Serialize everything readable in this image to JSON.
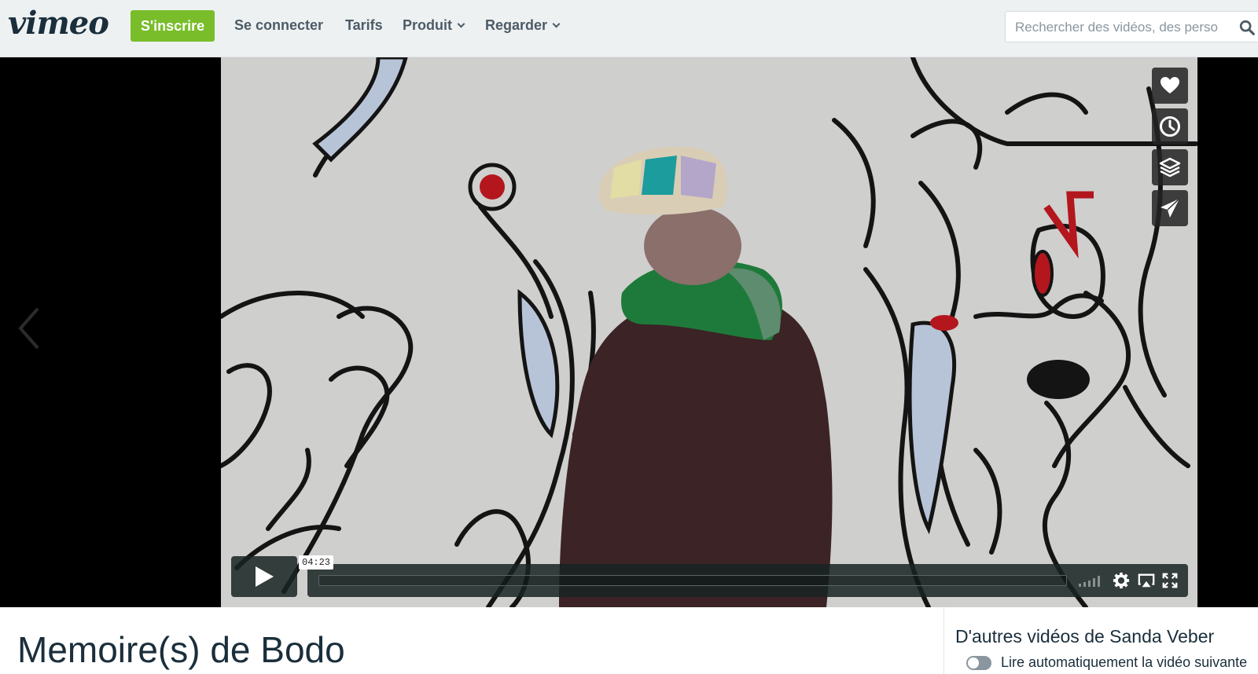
{
  "header": {
    "logo": "vimeo",
    "signup_label": "S'inscrire",
    "nav": [
      {
        "label": "Se connecter",
        "dropdown": false
      },
      {
        "label": "Tarifs",
        "dropdown": false
      },
      {
        "label": "Produit",
        "dropdown": true
      },
      {
        "label": "Regarder",
        "dropdown": true
      }
    ],
    "search_placeholder": "Rechercher des vidéos, des perso"
  },
  "player": {
    "timecode": "04:23",
    "side_actions": [
      "heart-icon",
      "clock-icon",
      "layers-icon",
      "send-icon"
    ],
    "controls": [
      "volume-icon",
      "gear-icon",
      "airplay-icon",
      "fullscreen-icon"
    ]
  },
  "video": {
    "title": "Memoire(s) de Bodo"
  },
  "related": {
    "title": "D'autres vidéos de Sanda Veber",
    "autoplay_label": "Lire automatiquement la vidéo suivante"
  },
  "colors": {
    "brand_green": "#79bd2a",
    "nav_bg": "#eef1f2",
    "text_dark": "#1a2e3b"
  }
}
